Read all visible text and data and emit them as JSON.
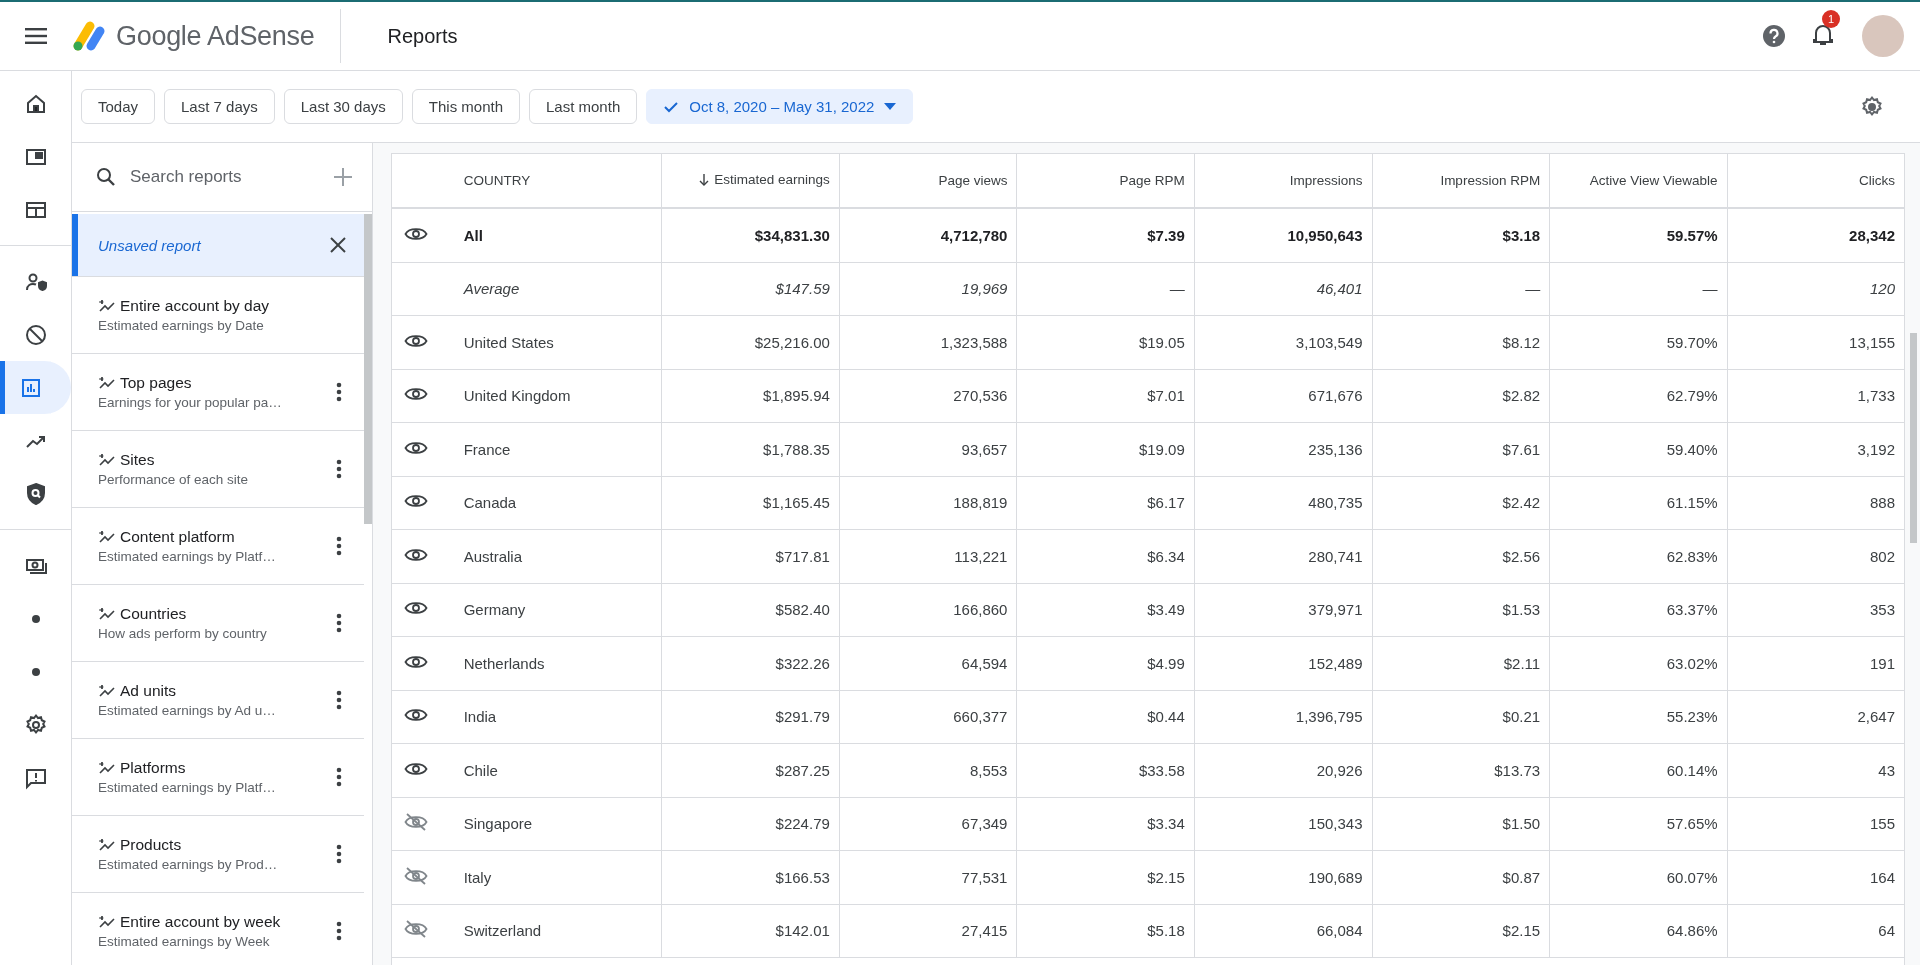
{
  "header": {
    "product": "Google AdSense",
    "page_title": "Reports",
    "notification_count": "1"
  },
  "nav_rail": [
    {
      "selected": false
    },
    {
      "selected": false
    },
    {
      "selected": false
    },
    {
      "selected": false
    },
    {
      "selected": false
    },
    {
      "selected": true
    },
    {
      "selected": false
    },
    {
      "selected": false
    },
    {
      "selected": false
    },
    {
      "selected": false
    },
    {
      "selected": false
    },
    {
      "selected": false
    },
    {
      "selected": false
    }
  ],
  "date_filters": [
    {
      "label": "Today",
      "selected": false
    },
    {
      "label": "Last 7 days",
      "selected": false
    },
    {
      "label": "Last 30 days",
      "selected": false
    },
    {
      "label": "This month",
      "selected": false
    },
    {
      "label": "Last month",
      "selected": false
    },
    {
      "label": "Oct 8, 2020 – May 31, 2022",
      "selected": true
    }
  ],
  "reports_panel": {
    "search": {
      "placeholder": "Search reports"
    },
    "current": {
      "label": "Unsaved report",
      "selected": true
    },
    "items": [
      {
        "title": "Entire account by day",
        "subtitle": "Estimated earnings by Date",
        "menu": false
      },
      {
        "title": "Top pages",
        "subtitle": "Earnings for your popular pa…",
        "menu": true
      },
      {
        "title": "Sites",
        "subtitle": "Performance of each site",
        "menu": true
      },
      {
        "title": "Content platform",
        "subtitle": "Estimated earnings by Platf…",
        "menu": true
      },
      {
        "title": "Countries",
        "subtitle": "How ads perform by country",
        "menu": true
      },
      {
        "title": "Ad units",
        "subtitle": "Estimated earnings by Ad u…",
        "menu": true
      },
      {
        "title": "Platforms",
        "subtitle": "Estimated earnings by Platf…",
        "menu": true
      },
      {
        "title": "Products",
        "subtitle": "Estimated earnings by Prod…",
        "menu": true
      },
      {
        "title": "Entire account by week",
        "subtitle": "Estimated earnings by Week",
        "menu": true
      }
    ]
  },
  "table": {
    "columns": [
      {
        "label": "COUNTRY",
        "sorted": false
      },
      {
        "label": "Estimated earnings",
        "sorted": true
      },
      {
        "label": "Page views",
        "sorted": false
      },
      {
        "label": "Page RPM",
        "sorted": false
      },
      {
        "label": "Impressions",
        "sorted": false
      },
      {
        "label": "Impression RPM",
        "sorted": false
      },
      {
        "label": "Active View Viewable",
        "sorted": false
      },
      {
        "label": "Clicks",
        "sorted": false
      }
    ],
    "rows": [
      {
        "kind": "total",
        "visible": true,
        "cells": [
          "All",
          "$34,831.30",
          "4,712,780",
          "$7.39",
          "10,950,643",
          "$3.18",
          "59.57%",
          "28,342"
        ]
      },
      {
        "kind": "average",
        "cells": [
          "Average",
          "$147.59",
          "19,969",
          "—",
          "46,401",
          "—",
          "—",
          "120"
        ]
      },
      {
        "kind": "country",
        "visible": true,
        "cells": [
          "United States",
          "$25,216.00",
          "1,323,588",
          "$19.05",
          "3,103,549",
          "$8.12",
          "59.70%",
          "13,155"
        ]
      },
      {
        "kind": "country",
        "visible": true,
        "cells": [
          "United Kingdom",
          "$1,895.94",
          "270,536",
          "$7.01",
          "671,676",
          "$2.82",
          "62.79%",
          "1,733"
        ]
      },
      {
        "kind": "country",
        "visible": true,
        "cells": [
          "France",
          "$1,788.35",
          "93,657",
          "$19.09",
          "235,136",
          "$7.61",
          "59.40%",
          "3,192"
        ]
      },
      {
        "kind": "country",
        "visible": true,
        "cells": [
          "Canada",
          "$1,165.45",
          "188,819",
          "$6.17",
          "480,735",
          "$2.42",
          "61.15%",
          "888"
        ]
      },
      {
        "kind": "country",
        "visible": true,
        "cells": [
          "Australia",
          "$717.81",
          "113,221",
          "$6.34",
          "280,741",
          "$2.56",
          "62.83%",
          "802"
        ]
      },
      {
        "kind": "country",
        "visible": true,
        "cells": [
          "Germany",
          "$582.40",
          "166,860",
          "$3.49",
          "379,971",
          "$1.53",
          "63.37%",
          "353"
        ]
      },
      {
        "kind": "country",
        "visible": true,
        "cells": [
          "Netherlands",
          "$322.26",
          "64,594",
          "$4.99",
          "152,489",
          "$2.11",
          "63.02%",
          "191"
        ]
      },
      {
        "kind": "country",
        "visible": true,
        "cells": [
          "India",
          "$291.79",
          "660,377",
          "$0.44",
          "1,396,795",
          "$0.21",
          "55.23%",
          "2,647"
        ]
      },
      {
        "kind": "country",
        "visible": true,
        "cells": [
          "Chile",
          "$287.25",
          "8,553",
          "$33.58",
          "20,926",
          "$13.73",
          "60.14%",
          "43"
        ]
      },
      {
        "kind": "country",
        "visible": false,
        "cells": [
          "Singapore",
          "$224.79",
          "67,349",
          "$3.34",
          "150,343",
          "$1.50",
          "57.65%",
          "155"
        ]
      },
      {
        "kind": "country",
        "visible": false,
        "cells": [
          "Italy",
          "$166.53",
          "77,531",
          "$2.15",
          "190,689",
          "$0.87",
          "60.07%",
          "164"
        ]
      },
      {
        "kind": "country",
        "visible": false,
        "cells": [
          "Switzerland",
          "$142.01",
          "27,415",
          "$5.18",
          "66,084",
          "$2.15",
          "64.86%",
          "64"
        ]
      }
    ]
  }
}
